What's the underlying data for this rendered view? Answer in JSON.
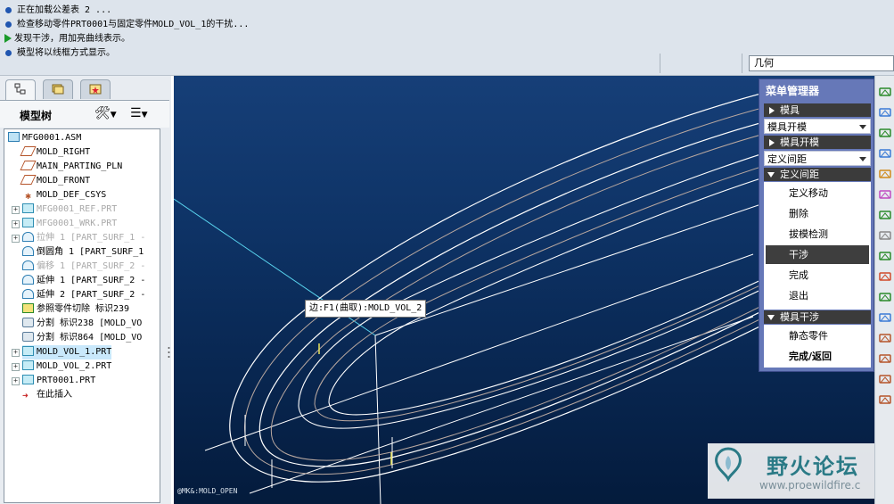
{
  "messages": [
    {
      "icon": "bullet",
      "text": "正在加载公差表 2 ..."
    },
    {
      "icon": "bullet",
      "text": "检查移动零件PRT0001与固定零件MOLD_VOL_1的干扰..."
    },
    {
      "icon": "arrow",
      "text": "发现干涉，用加亮曲线表示。"
    },
    {
      "icon": "bullet",
      "text": "模型将以线框方式显示。"
    }
  ],
  "filter": {
    "value": "几何"
  },
  "left_panel": {
    "tabs": [
      "model-tree-tab",
      "folder-tab",
      "favorites-tab"
    ],
    "title": "模型树",
    "tree": [
      {
        "label": "MFG0001.ASM",
        "icon": "assembly",
        "level": 0,
        "state": "normal"
      },
      {
        "label": "MOLD_RIGHT",
        "icon": "datum-plane",
        "level": 1,
        "state": "normal"
      },
      {
        "label": "MAIN_PARTING_PLN",
        "icon": "datum-plane",
        "level": 1,
        "state": "normal"
      },
      {
        "label": "MOLD_FRONT",
        "icon": "datum-plane",
        "level": 1,
        "state": "normal"
      },
      {
        "label": "MOLD_DEF_CSYS",
        "icon": "csys",
        "level": 1,
        "state": "normal"
      },
      {
        "label": "MFG0001_REF.PRT",
        "icon": "part",
        "level": 1,
        "state": "dim",
        "expandable": true
      },
      {
        "label": "MFG0001_WRK.PRT",
        "icon": "part",
        "level": 1,
        "state": "dim",
        "expandable": true
      },
      {
        "label": "拉伸 1 [PART_SURF_1 -",
        "icon": "surface",
        "level": 1,
        "state": "dim",
        "expandable": true
      },
      {
        "label": "倒圆角 1 [PART_SURF_1",
        "icon": "surface",
        "level": 1,
        "state": "normal"
      },
      {
        "label": "偏移 1 [PART_SURF_2 -",
        "icon": "surface",
        "level": 1,
        "state": "dim"
      },
      {
        "label": "延伸 1 [PART_SURF_2 -",
        "icon": "surface",
        "level": 1,
        "state": "normal"
      },
      {
        "label": "延伸 2 [PART_SURF_2 -",
        "icon": "surface",
        "level": 1,
        "state": "normal"
      },
      {
        "label": "参照零件切除 标识239",
        "icon": "cut",
        "level": 1,
        "state": "normal"
      },
      {
        "label": "分割 标识238 [MOLD_VO",
        "icon": "split",
        "level": 1,
        "state": "normal"
      },
      {
        "label": "分割 标识864 [MOLD_VO",
        "icon": "split",
        "level": 1,
        "state": "normal"
      },
      {
        "label": "MOLD_VOL_1.PRT",
        "icon": "part",
        "level": 1,
        "state": "selected",
        "expandable": true
      },
      {
        "label": "MOLD_VOL_2.PRT",
        "icon": "part",
        "level": 1,
        "state": "normal",
        "expandable": true
      },
      {
        "label": "PRT0001.PRT",
        "icon": "part",
        "level": 1,
        "state": "normal",
        "expandable": true
      },
      {
        "label": "在此插入",
        "icon": "insert-here",
        "level": 1,
        "state": "normal"
      }
    ]
  },
  "graphics": {
    "tooltip_label": "边:F1(曲取):",
    "tooltip_value": "MOLD_VOL_2",
    "view_label": "@MK&:MOLD_OPEN"
  },
  "watermark": {
    "name": "野火论坛",
    "url": "www.proewildfire.c"
  },
  "menu_manager": {
    "title": "菜单管理器",
    "sections": [
      {
        "header": "模具",
        "header_state": "collapsed",
        "dropdown": "模具开模"
      },
      {
        "header": "模具开模",
        "header_state": "collapsed",
        "dropdown": "定义间距"
      },
      {
        "header": "定义间距",
        "header_state": "expanded",
        "items": [
          "定义移动",
          "删除",
          "拔模检测",
          "干涉",
          "完成",
          "退出"
        ],
        "active": "干涉"
      },
      {
        "header": "模具干涉",
        "header_state": "expanded",
        "items": [
          "静态零件",
          "完成/返回"
        ],
        "bold": "完成/返回"
      }
    ]
  },
  "colors": {
    "graphics_top": "#163f78",
    "graphics_bottom": "#041b3c",
    "wireframe": "#ffffff",
    "hidden_lines": "#b9a8a0",
    "datum_plane": "#59d4ee",
    "interference_highlight": "#e8e25a",
    "menu_background": "#6678b8",
    "selection_background": "#c9e8fb"
  },
  "right_toolbar_icons": [
    "axis-icon",
    "plane-from-surface-icon",
    "extrude-icon",
    "revolve-icon",
    "sweep-icon",
    "skirt-icon",
    "shutoff-icon",
    "move-icon",
    "copy-icon",
    "split-volume-icon",
    "insert-icon",
    "wave-curve-icon",
    "datum-plane-icon",
    "datum-axis-icon",
    "curve-icon",
    "point-icon"
  ]
}
